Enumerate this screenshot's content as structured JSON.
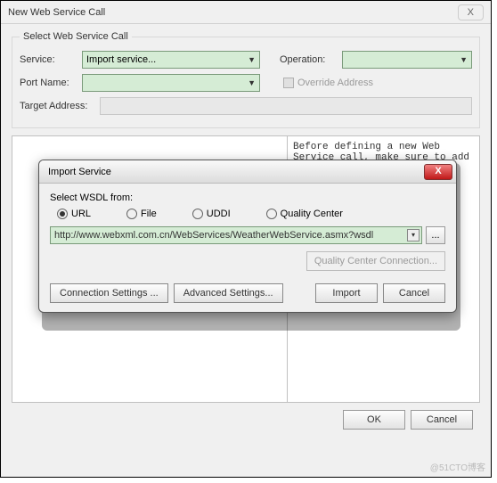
{
  "window": {
    "title": "New Web Service Call",
    "close_glyph": "X"
  },
  "group": {
    "legend": "Select Web Service Call",
    "service_label": "Service:",
    "service_value": "Import service...",
    "operation_label": "Operation:",
    "operation_value": "",
    "port_label": "Port Name:",
    "port_value": "",
    "override_label": "Override Address",
    "target_label": "Target Address:"
  },
  "info_text": "Before defining a new Web Service call, make sure to add the service to the test",
  "modal": {
    "title": "Import Service",
    "select_label": "Select WSDL from:",
    "radios": {
      "url": "URL",
      "file": "File",
      "uddi": "UDDI",
      "qc": "Quality Center"
    },
    "url_value": "http://www.webxml.com.cn/WebServices/WeatherWebService.asmx?wsdl",
    "browse": "...",
    "qc_conn": "Quality Center Connection...",
    "conn_settings": "Connection Settings ...",
    "adv_settings": "Advanced Settings...",
    "import": "Import",
    "cancel": "Cancel"
  },
  "buttons": {
    "ok": "OK",
    "cancel": "Cancel"
  },
  "watermark": "@51CTO博客"
}
